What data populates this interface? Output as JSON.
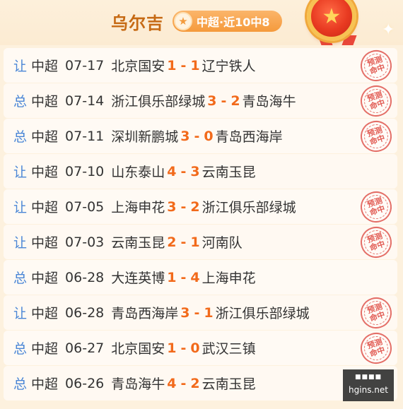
{
  "header": {
    "tipster_name": "乌尔吉",
    "record": "中超·近10中8",
    "star_icon": "star-icon",
    "medal_icon": "medal-star-icon"
  },
  "colors": {
    "accent_orange": "#c66a14",
    "score_orange": "#f26a1b",
    "tag_blue": "#4a86d6",
    "stamp_red": "#e25d55"
  },
  "stamp_label": "预测命中",
  "matches": [
    {
      "tag": "让",
      "league": "中超",
      "date": "07-17",
      "home": "北京国安",
      "home_score": "1",
      "sep": "-",
      "away_score": "1",
      "away": "辽宁铁人",
      "hit": true
    },
    {
      "tag": "总",
      "league": "中超",
      "date": "07-14",
      "home": "浙江俱乐部绿城",
      "home_score": "3",
      "sep": "-",
      "away_score": "2",
      "away": "青岛海牛",
      "hit": true
    },
    {
      "tag": "总",
      "league": "中超",
      "date": "07-11",
      "home": "深圳新鹏城",
      "home_score": "3",
      "sep": "-",
      "away_score": "0",
      "away": "青岛西海岸",
      "hit": true
    },
    {
      "tag": "让",
      "league": "中超",
      "date": "07-10",
      "home": "山东泰山",
      "home_score": "4",
      "sep": "-",
      "away_score": "3",
      "away": "云南玉昆",
      "hit": false
    },
    {
      "tag": "让",
      "league": "中超",
      "date": "07-05",
      "home": "上海申花",
      "home_score": "3",
      "sep": "-",
      "away_score": "2",
      "away": "浙江俱乐部绿城",
      "hit": true
    },
    {
      "tag": "让",
      "league": "中超",
      "date": "07-03",
      "home": "云南玉昆",
      "home_score": "2",
      "sep": "-",
      "away_score": "1",
      "away": "河南队",
      "hit": true
    },
    {
      "tag": "总",
      "league": "中超",
      "date": "06-28",
      "home": "大连英博",
      "home_score": "1",
      "sep": "-",
      "away_score": "4",
      "away": "上海申花",
      "hit": false
    },
    {
      "tag": "让",
      "league": "中超",
      "date": "06-28",
      "home": "青岛西海岸",
      "home_score": "3",
      "sep": "-",
      "away_score": "1",
      "away": "浙江俱乐部绿城",
      "hit": true
    },
    {
      "tag": "总",
      "league": "中超",
      "date": "06-27",
      "home": "北京国安",
      "home_score": "1",
      "sep": "-",
      "away_score": "0",
      "away": "武汉三镇",
      "hit": true
    },
    {
      "tag": "总",
      "league": "中超",
      "date": "06-26",
      "home": "青岛海牛",
      "home_score": "4",
      "sep": "-",
      "away_score": "2",
      "away": "云南玉昆",
      "hit": false
    }
  ],
  "watermark": {
    "top": "■■■■",
    "bottom": "hgins.net"
  }
}
